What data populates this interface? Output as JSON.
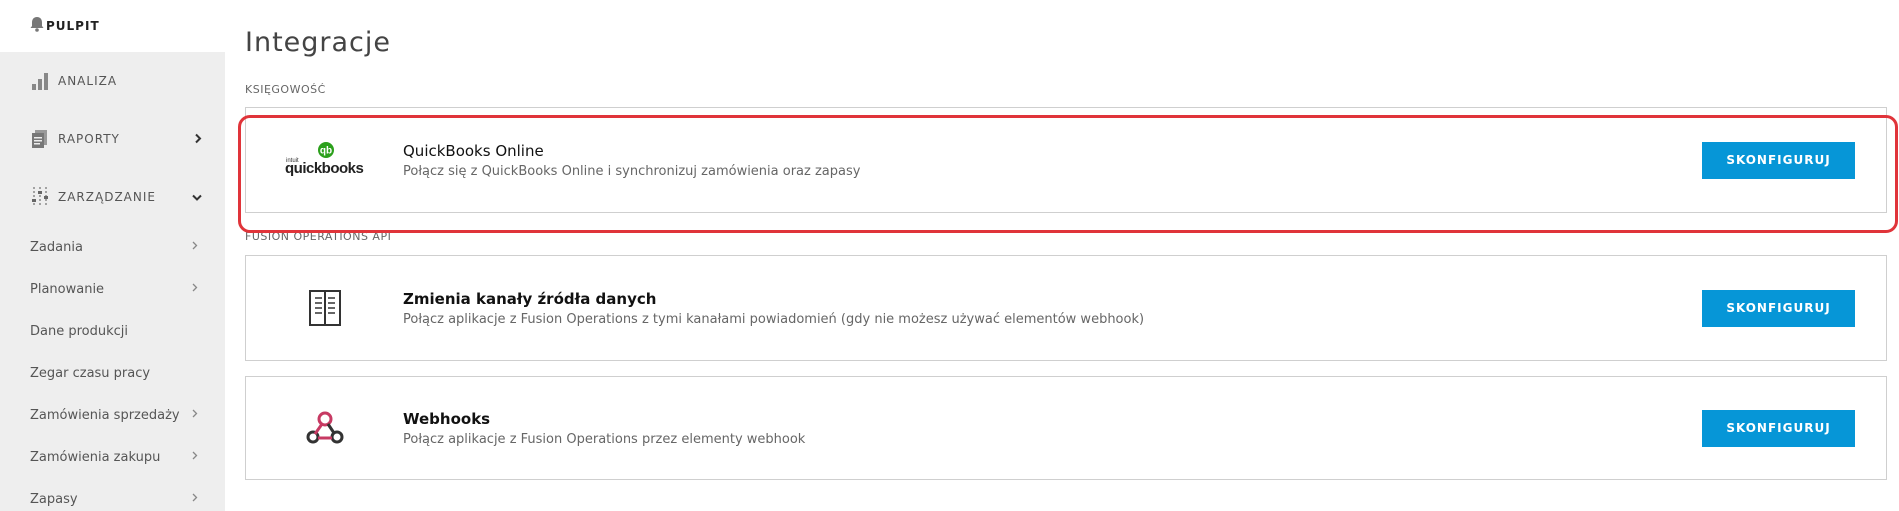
{
  "sidebar": {
    "top": {
      "label": "PULPIT",
      "icon": "bell-icon"
    },
    "items": [
      {
        "label": "ANALIZA",
        "icon": "bar-chart-icon"
      },
      {
        "label": "RAPORTY",
        "icon": "report-icon"
      },
      {
        "label": "ZARZĄDZANIE",
        "icon": "sliders-icon"
      }
    ],
    "subitems": [
      {
        "label": "Zadania"
      },
      {
        "label": "Planowanie"
      },
      {
        "label": "Dane produkcji"
      },
      {
        "label": "Zegar czasu pracy"
      },
      {
        "label": "Zamówienia sprzedaży"
      },
      {
        "label": "Zamówienia zakupu"
      },
      {
        "label": "Zapasy"
      }
    ]
  },
  "main": {
    "title": "Integracje",
    "sections": [
      {
        "label": "KSIĘGOWOŚĆ",
        "cards": [
          {
            "logo_text_small": "intuit",
            "logo_text": "quickbooks",
            "logo_badge": "qb",
            "title": "QuickBooks Online",
            "description": "Połącz się z QuickBooks Online i synchronizuj zamówienia oraz zapasy",
            "button": "SKONFIGURUJ"
          }
        ]
      },
      {
        "label": "FUSION OPERATIONS API",
        "cards": [
          {
            "title": "Zmienia kanały źródła danych",
            "description": "Połącz aplikacje z Fusion Operations z tymi kanałami powiadomień (gdy nie możesz używać elementów webhook)",
            "button": "SKONFIGURUJ",
            "icon": "book-icon"
          },
          {
            "title": "Webhooks",
            "description": "Połącz aplikacje z Fusion Operations przez elementy webhook",
            "button": "SKONFIGURUJ",
            "icon": "webhook-icon"
          }
        ]
      }
    ]
  },
  "colors": {
    "accent": "#0696d7",
    "highlight": "#e0343a",
    "quickbooks_green": "#2ca01c",
    "webhook_pink": "#c73a63"
  }
}
